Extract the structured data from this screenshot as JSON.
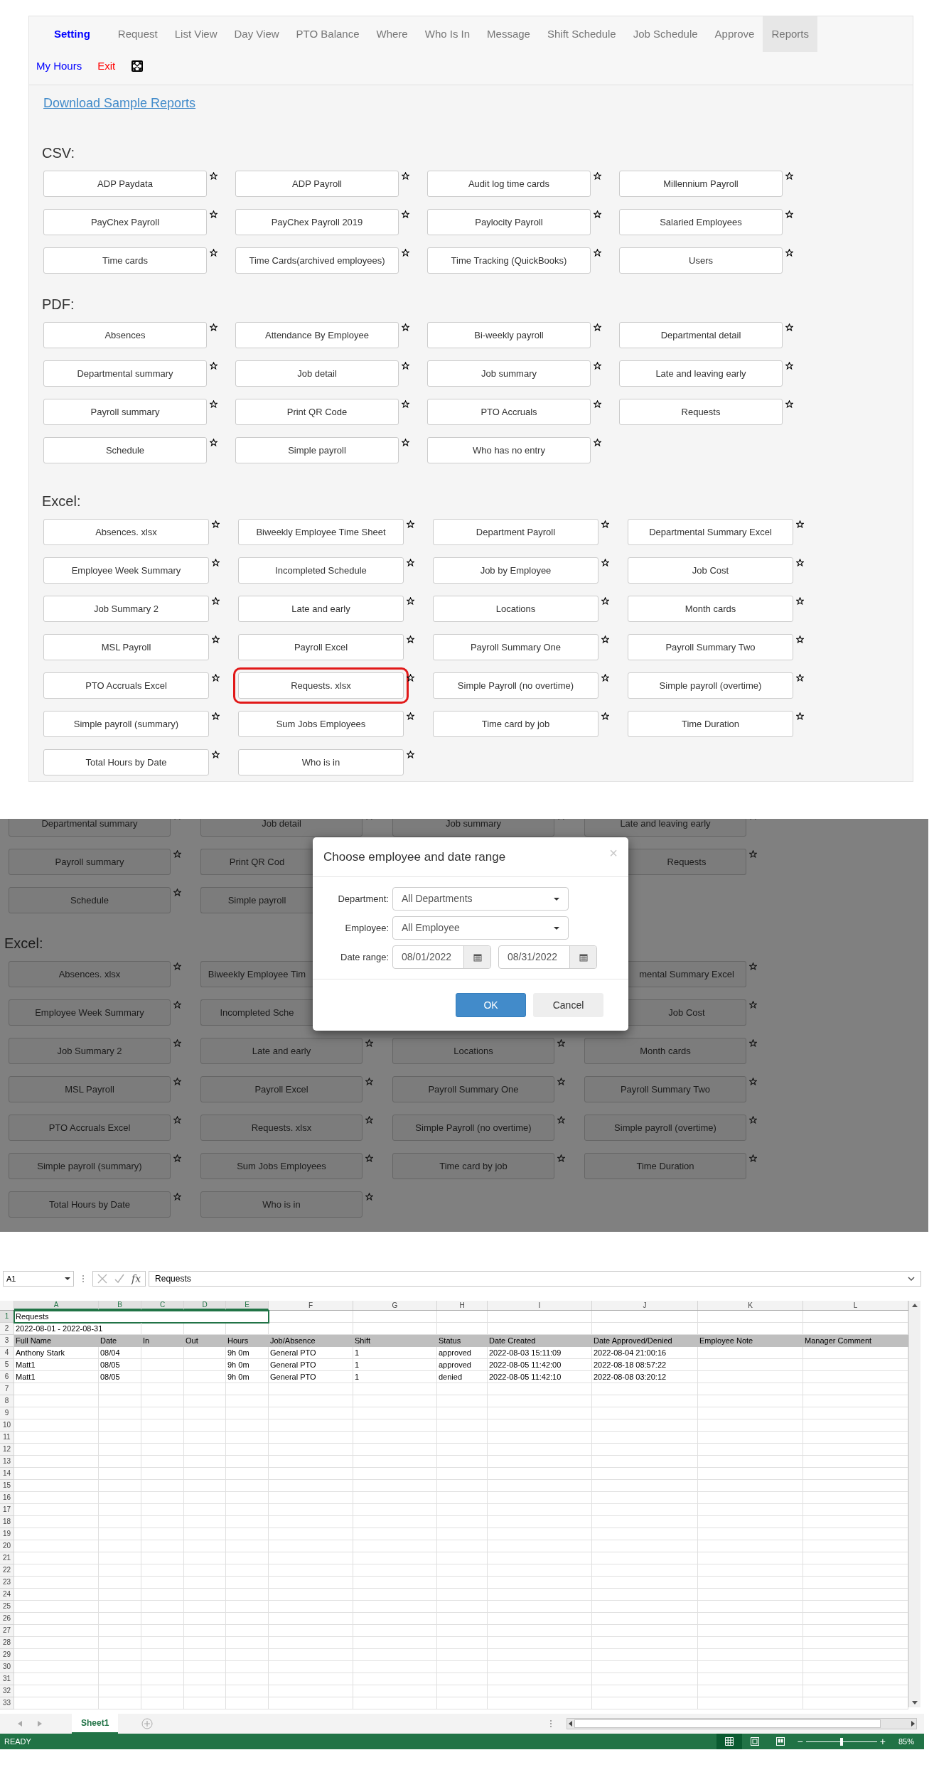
{
  "nav": {
    "items": [
      {
        "label": "Setting",
        "kind": "brand",
        "selected": false
      },
      {
        "label": "Request",
        "kind": "tab",
        "selected": false
      },
      {
        "label": "List View",
        "kind": "tab",
        "selected": false
      },
      {
        "label": "Day View",
        "kind": "tab",
        "selected": false
      },
      {
        "label": "PTO Balance",
        "kind": "tab",
        "selected": false
      },
      {
        "label": "Where",
        "kind": "tab",
        "selected": false
      },
      {
        "label": "Who Is In",
        "kind": "tab",
        "selected": false
      },
      {
        "label": "Message",
        "kind": "tab",
        "selected": false
      },
      {
        "label": "Shift Schedule",
        "kind": "tab",
        "selected": false
      },
      {
        "label": "Job Schedule",
        "kind": "tab",
        "selected": false
      },
      {
        "label": "Approve",
        "kind": "tab",
        "selected": false
      },
      {
        "label": "Reports",
        "kind": "tab",
        "selected": true
      }
    ],
    "secondary": [
      {
        "label": "My Hours",
        "kind": "link"
      },
      {
        "label": "Exit",
        "kind": "exit"
      }
    ]
  },
  "download_link": "Download Sample Reports",
  "sections": [
    {
      "heading": "CSV:",
      "reports": [
        {
          "label": "ADP Paydata",
          "highlighted": false
        },
        {
          "label": "ADP Payroll",
          "highlighted": false
        },
        {
          "label": "Audit log time cards",
          "highlighted": false
        },
        {
          "label": "Millennium Payroll",
          "highlighted": false
        },
        {
          "label": "PayChex Payroll",
          "highlighted": false
        },
        {
          "label": "PayChex Payroll 2019",
          "highlighted": false
        },
        {
          "label": "Paylocity Payroll",
          "highlighted": false
        },
        {
          "label": "Salaried Employees",
          "highlighted": false
        },
        {
          "label": "Time cards",
          "highlighted": false
        },
        {
          "label": "Time Cards(archived employees)",
          "highlighted": false
        },
        {
          "label": "Time Tracking (QuickBooks)",
          "highlighted": false
        },
        {
          "label": "Users",
          "highlighted": false
        }
      ]
    },
    {
      "heading": "PDF:",
      "reports": [
        {
          "label": "Absences",
          "highlighted": false
        },
        {
          "label": "Attendance By Employee",
          "highlighted": false
        },
        {
          "label": "Bi-weekly payroll",
          "highlighted": false
        },
        {
          "label": "Departmental detail",
          "highlighted": false
        },
        {
          "label": "Departmental summary",
          "highlighted": false
        },
        {
          "label": "Job detail",
          "highlighted": false
        },
        {
          "label": "Job summary",
          "highlighted": false
        },
        {
          "label": "Late and leaving early",
          "highlighted": false
        },
        {
          "label": "Payroll summary",
          "highlighted": false
        },
        {
          "label": "Print QR Code",
          "highlighted": false
        },
        {
          "label": "PTO Accruals",
          "highlighted": false
        },
        {
          "label": "Requests",
          "highlighted": false
        },
        {
          "label": "Schedule",
          "highlighted": false
        },
        {
          "label": "Simple payroll",
          "highlighted": false
        },
        {
          "label": "Who has no entry",
          "highlighted": false
        }
      ]
    },
    {
      "heading": "Excel:",
      "reports": [
        {
          "label": "Absences. xlsx",
          "highlighted": false
        },
        {
          "label": "Biweekly Employee Time Sheet",
          "highlighted": false
        },
        {
          "label": "Department Payroll",
          "highlighted": false
        },
        {
          "label": "Departmental Summary Excel",
          "highlighted": false
        },
        {
          "label": "Employee Week Summary",
          "highlighted": false
        },
        {
          "label": "Incompleted Schedule",
          "highlighted": false
        },
        {
          "label": "Job by Employee",
          "highlighted": false
        },
        {
          "label": "Job Cost",
          "highlighted": false
        },
        {
          "label": "Job Summary 2",
          "highlighted": false
        },
        {
          "label": "Late and early",
          "highlighted": false
        },
        {
          "label": "Locations",
          "highlighted": false
        },
        {
          "label": "Month cards",
          "highlighted": false
        },
        {
          "label": "MSL Payroll",
          "highlighted": false
        },
        {
          "label": "Payroll Excel",
          "highlighted": false
        },
        {
          "label": "Payroll Summary One",
          "highlighted": false
        },
        {
          "label": "Payroll Summary Two",
          "highlighted": false
        },
        {
          "label": "PTO Accruals Excel",
          "highlighted": false
        },
        {
          "label": "Requests. xlsx",
          "highlighted": true
        },
        {
          "label": "Simple Payroll (no overtime)",
          "highlighted": false
        },
        {
          "label": "Simple payroll (overtime)",
          "highlighted": false
        },
        {
          "label": "Simple payroll (summary)",
          "highlighted": false
        },
        {
          "label": "Sum Jobs Employees",
          "highlighted": false
        },
        {
          "label": "Time card by job",
          "highlighted": false
        },
        {
          "label": "Time Duration",
          "highlighted": false
        },
        {
          "label": "Total Hours by Date",
          "highlighted": false
        },
        {
          "label": "Who is in",
          "highlighted": false
        }
      ]
    }
  ],
  "dialog_screen": {
    "top_rows": [
      {
        "left": [
          {
            "label": "Departmental summary",
            "cut": false
          },
          {
            "label": "Job detail",
            "cut": false
          },
          {
            "label": "Job summary",
            "cut": false
          },
          {
            "label": "Late and leaving early",
            "cut": false
          }
        ],
        "right": []
      },
      {
        "left": [
          {
            "label": "Payroll summary",
            "cut": false
          },
          {
            "label": "Print QR Cod",
            "cut": true
          }
        ],
        "right": [
          {
            "label": "Requests",
            "cut": true
          }
        ]
      },
      {
        "left": [
          {
            "label": "Schedule",
            "cut": false
          },
          {
            "label": "Simple payroll",
            "cut": true
          }
        ],
        "right": []
      }
    ],
    "excel_heading": "Excel:",
    "excel_rows": [
      {
        "left": [
          {
            "label": "Absences. xlsx",
            "cut": false
          },
          {
            "label": "Biweekly Employee Tim",
            "cut": true
          }
        ],
        "right": [
          {
            "label": "mental Summary Excel",
            "cut": true
          }
        ]
      },
      {
        "left": [
          {
            "label": "Employee Week Summary",
            "cut": false
          },
          {
            "label": "Incompleted Sche",
            "cut": true
          }
        ],
        "right": [
          {
            "label": "Job Cost",
            "cut": true
          }
        ]
      },
      {
        "left": [
          {
            "label": "Job Summary 2",
            "cut": false
          },
          {
            "label": "Late and early",
            "cut": false
          },
          {
            "label": "Locations",
            "cut": false
          },
          {
            "label": "Month cards",
            "cut": false
          }
        ],
        "right": []
      },
      {
        "left": [
          {
            "label": "MSL Payroll",
            "cut": false
          },
          {
            "label": "Payroll Excel",
            "cut": false
          },
          {
            "label": "Payroll Summary One",
            "cut": false
          },
          {
            "label": "Payroll Summary Two",
            "cut": false
          }
        ],
        "right": []
      },
      {
        "left": [
          {
            "label": "PTO Accruals Excel",
            "cut": false
          },
          {
            "label": "Requests. xlsx",
            "cut": false
          },
          {
            "label": "Simple Payroll (no overtime)",
            "cut": false
          },
          {
            "label": "Simple payroll (overtime)",
            "cut": false
          }
        ],
        "right": []
      },
      {
        "left": [
          {
            "label": "Simple payroll (summary)",
            "cut": false
          },
          {
            "label": "Sum Jobs Employees",
            "cut": false
          },
          {
            "label": "Time card by job",
            "cut": false
          },
          {
            "label": "Time Duration",
            "cut": false
          }
        ],
        "right": []
      },
      {
        "left": [
          {
            "label": "Total Hours by Date",
            "cut": false
          },
          {
            "label": "Who is in",
            "cut": false
          }
        ],
        "right": []
      }
    ],
    "dialog": {
      "title": "Choose employee and date range",
      "close": "×",
      "fields": [
        {
          "label": "Department:",
          "kind": "select",
          "value": "All Departments"
        },
        {
          "label": "Employee:",
          "kind": "select",
          "value": "All Employee"
        },
        {
          "label": "Date range:",
          "kind": "date_range",
          "start": "08/01/2022",
          "end": "08/31/2022"
        }
      ],
      "buttons": [
        {
          "label": "OK",
          "kind": "primary"
        },
        {
          "label": "Cancel",
          "kind": "default"
        }
      ]
    }
  },
  "spreadsheet": {
    "name_box": "A1",
    "function_label": "fx",
    "formula": "Requests",
    "columns": [
      {
        "label": "A",
        "selected": true
      },
      {
        "label": "B",
        "selected": true
      },
      {
        "label": "C",
        "selected": true
      },
      {
        "label": "D",
        "selected": true
      },
      {
        "label": "E",
        "selected": true
      },
      {
        "label": "F",
        "selected": false
      },
      {
        "label": "G",
        "selected": false
      },
      {
        "label": "H",
        "selected": false
      },
      {
        "label": "I",
        "selected": false
      },
      {
        "label": "J",
        "selected": false
      },
      {
        "label": "K",
        "selected": false
      },
      {
        "label": "L",
        "selected": false
      }
    ],
    "rows": [
      {
        "number": "1",
        "kind": "title",
        "selected": true,
        "cells": [
          "Requests"
        ]
      },
      {
        "number": "2",
        "kind": "plain",
        "selected": false,
        "cells": [
          "2022-08-01 - 2022-08-31"
        ]
      },
      {
        "number": "3",
        "kind": "header",
        "selected": false,
        "cells": [
          "Full Name",
          "Date",
          "In",
          "Out",
          "Hours",
          "Job/Absence",
          "Shift",
          "Status",
          "Date Created",
          "Date Approved/Denied",
          "Employee Note",
          "Manager Comment"
        ]
      },
      {
        "number": "4",
        "kind": "plain",
        "selected": false,
        "cells": [
          "Anthony Stark",
          "08/04",
          null,
          null,
          "9h 0m",
          "General PTO",
          "1",
          "approved",
          "2022-08-03 15:11:09",
          "2022-08-04 21:00:16",
          null,
          null
        ]
      },
      {
        "number": "5",
        "kind": "plain",
        "selected": false,
        "cells": [
          "Matt1",
          "08/05",
          null,
          null,
          "9h 0m",
          "General PTO",
          "1",
          "approved",
          "2022-08-05 11:42:00",
          "2022-08-18 08:57:22",
          null,
          null
        ]
      },
      {
        "number": "6",
        "kind": "plain",
        "selected": false,
        "cells": [
          "Matt1",
          "08/05",
          null,
          null,
          "9h 0m",
          "General PTO",
          "1",
          "denied",
          "2022-08-05 11:42:10",
          "2022-08-08 03:20:12",
          null,
          null
        ]
      },
      {
        "number": "7",
        "kind": "plain",
        "selected": false,
        "cells": []
      },
      {
        "number": "8",
        "kind": "plain",
        "selected": false,
        "cells": []
      },
      {
        "number": "9",
        "kind": "plain",
        "selected": false,
        "cells": []
      },
      {
        "number": "10",
        "kind": "plain",
        "selected": false,
        "cells": []
      },
      {
        "number": "11",
        "kind": "plain",
        "selected": false,
        "cells": []
      },
      {
        "number": "12",
        "kind": "plain",
        "selected": false,
        "cells": []
      },
      {
        "number": "13",
        "kind": "plain",
        "selected": false,
        "cells": []
      },
      {
        "number": "14",
        "kind": "plain",
        "selected": false,
        "cells": []
      },
      {
        "number": "15",
        "kind": "plain",
        "selected": false,
        "cells": []
      },
      {
        "number": "16",
        "kind": "plain",
        "selected": false,
        "cells": []
      },
      {
        "number": "17",
        "kind": "plain",
        "selected": false,
        "cells": []
      },
      {
        "number": "18",
        "kind": "plain",
        "selected": false,
        "cells": []
      },
      {
        "number": "19",
        "kind": "plain",
        "selected": false,
        "cells": []
      },
      {
        "number": "20",
        "kind": "plain",
        "selected": false,
        "cells": []
      },
      {
        "number": "21",
        "kind": "plain",
        "selected": false,
        "cells": []
      },
      {
        "number": "22",
        "kind": "plain",
        "selected": false,
        "cells": []
      },
      {
        "number": "23",
        "kind": "plain",
        "selected": false,
        "cells": []
      },
      {
        "number": "24",
        "kind": "plain",
        "selected": false,
        "cells": []
      },
      {
        "number": "25",
        "kind": "plain",
        "selected": false,
        "cells": []
      },
      {
        "number": "26",
        "kind": "plain",
        "selected": false,
        "cells": []
      },
      {
        "number": "27",
        "kind": "plain",
        "selected": false,
        "cells": []
      },
      {
        "number": "28",
        "kind": "plain",
        "selected": false,
        "cells": []
      },
      {
        "number": "29",
        "kind": "plain",
        "selected": false,
        "cells": []
      },
      {
        "number": "30",
        "kind": "plain",
        "selected": false,
        "cells": []
      },
      {
        "number": "31",
        "kind": "plain",
        "selected": false,
        "cells": []
      },
      {
        "number": "32",
        "kind": "plain",
        "selected": false,
        "cells": []
      },
      {
        "number": "33",
        "kind": "plain",
        "selected": false,
        "cells": []
      }
    ],
    "sheet_tabs": [
      {
        "label": "Sheet1",
        "selected": true
      }
    ],
    "status": "READY",
    "zoom_out": "−",
    "zoom_slider": {
      "level": 0.5
    },
    "zoom_in": "+",
    "zoom": "85%"
  }
}
